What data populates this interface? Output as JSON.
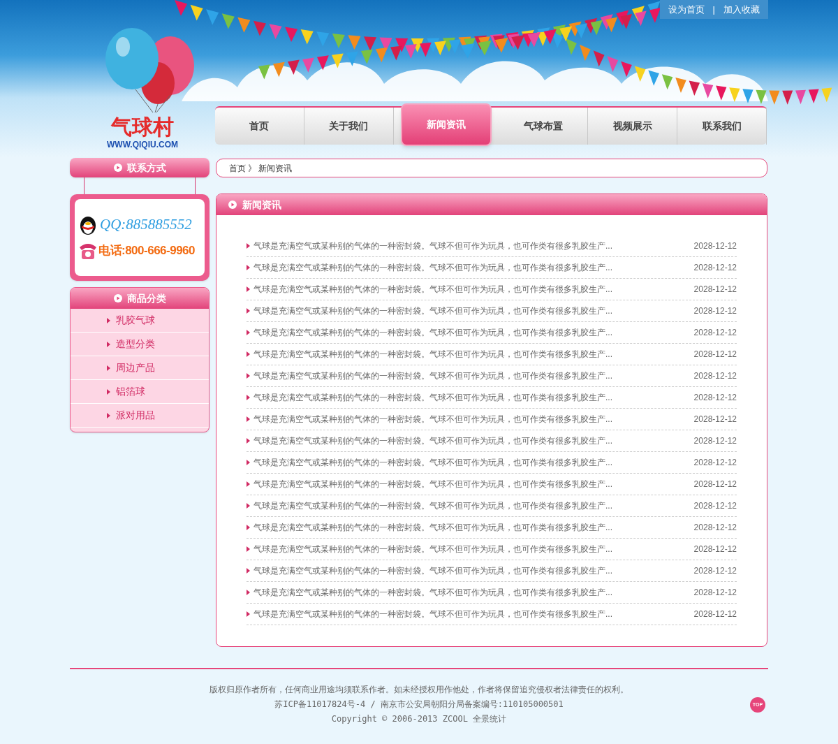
{
  "top_links": {
    "items": [
      "设为首页",
      "加入收藏"
    ],
    "separator": "|"
  },
  "logo": {
    "name": "气球村",
    "url": "WWW.QIQIU.COM"
  },
  "nav": [
    {
      "label": "首页",
      "selected": false
    },
    {
      "label": "关于我们",
      "selected": false
    },
    {
      "label": "新闻资讯",
      "selected": true
    },
    {
      "label": "气球布置",
      "selected": false
    },
    {
      "label": "视频展示",
      "selected": false
    },
    {
      "label": "联系我们",
      "selected": false
    }
  ],
  "contact": {
    "title": "联系方式",
    "qq": "QQ:885885552",
    "phone": "电话:800-666-9960"
  },
  "categories": {
    "title": "商品分类",
    "items": [
      "乳胶气球",
      "造型分类",
      "周边产品",
      "铝箔球",
      "派对用品"
    ]
  },
  "breadcrumb": {
    "items": [
      "首页",
      "新闻资讯"
    ],
    "separator": "》"
  },
  "news": {
    "title": "新闻资讯",
    "rows": [
      {
        "title": "气球是充满空气或某种别的气体的一种密封袋。气球不但可作为玩具，也可作类有很多乳胶生产...",
        "date": "2028-12-12"
      },
      {
        "title": "气球是充满空气或某种别的气体的一种密封袋。气球不但可作为玩具，也可作类有很多乳胶生产...",
        "date": "2028-12-12"
      },
      {
        "title": "气球是充满空气或某种别的气体的一种密封袋。气球不但可作为玩具，也可作类有很多乳胶生产...",
        "date": "2028-12-12"
      },
      {
        "title": "气球是充满空气或某种别的气体的一种密封袋。气球不但可作为玩具，也可作类有很多乳胶生产...",
        "date": "2028-12-12"
      },
      {
        "title": "气球是充满空气或某种别的气体的一种密封袋。气球不但可作为玩具，也可作类有很多乳胶生产...",
        "date": "2028-12-12"
      },
      {
        "title": "气球是充满空气或某种别的气体的一种密封袋。气球不但可作为玩具，也可作类有很多乳胶生产...",
        "date": "2028-12-12"
      },
      {
        "title": "气球是充满空气或某种别的气体的一种密封袋。气球不但可作为玩具，也可作类有很多乳胶生产...",
        "date": "2028-12-12"
      },
      {
        "title": "气球是充满空气或某种别的气体的一种密封袋。气球不但可作为玩具，也可作类有很多乳胶生产...",
        "date": "2028-12-12"
      },
      {
        "title": "气球是充满空气或某种别的气体的一种密封袋。气球不但可作为玩具，也可作类有很多乳胶生产...",
        "date": "2028-12-12"
      },
      {
        "title": "气球是充满空气或某种别的气体的一种密封袋。气球不但可作为玩具，也可作类有很多乳胶生产...",
        "date": "2028-12-12"
      },
      {
        "title": "气球是充满空气或某种别的气体的一种密封袋。气球不但可作为玩具，也可作类有很多乳胶生产...",
        "date": "2028-12-12"
      },
      {
        "title": "气球是充满空气或某种别的气体的一种密封袋。气球不但可作为玩具，也可作类有很多乳胶生产...",
        "date": "2028-12-12"
      },
      {
        "title": "气球是充满空气或某种别的气体的一种密封袋。气球不但可作为玩具，也可作类有很多乳胶生产...",
        "date": "2028-12-12"
      },
      {
        "title": "气球是充满空气或某种别的气体的一种密封袋。气球不但可作为玩具，也可作类有很多乳胶生产...",
        "date": "2028-12-12"
      },
      {
        "title": "气球是充满空气或某种别的气体的一种密封袋。气球不但可作为玩具，也可作类有很多乳胶生产...",
        "date": "2028-12-12"
      },
      {
        "title": "气球是充满空气或某种别的气体的一种密封袋。气球不但可作为玩具，也可作类有很多乳胶生产...",
        "date": "2028-12-12"
      },
      {
        "title": "气球是充满空气或某种别的气体的一种密封袋。气球不但可作为玩具，也可作类有很多乳胶生产...",
        "date": "2028-12-12"
      },
      {
        "title": "气球是充满空气或某种别的气体的一种密封袋。气球不但可作为玩具，也可作类有很多乳胶生产...",
        "date": "2028-12-12"
      }
    ]
  },
  "footer": {
    "lines": [
      "版权归原作者所有，任何商业用途均须联系作者。如未经授权用作他处，作者将保留追究侵权者法律责任的权利。",
      "苏ICP备11017824号-4 / 南京市公安局朝阳分局备案编号:110105000501",
      "Copyright © 2006-2013 ZCOOL 全景统计"
    ],
    "top_button": "TOP"
  }
}
